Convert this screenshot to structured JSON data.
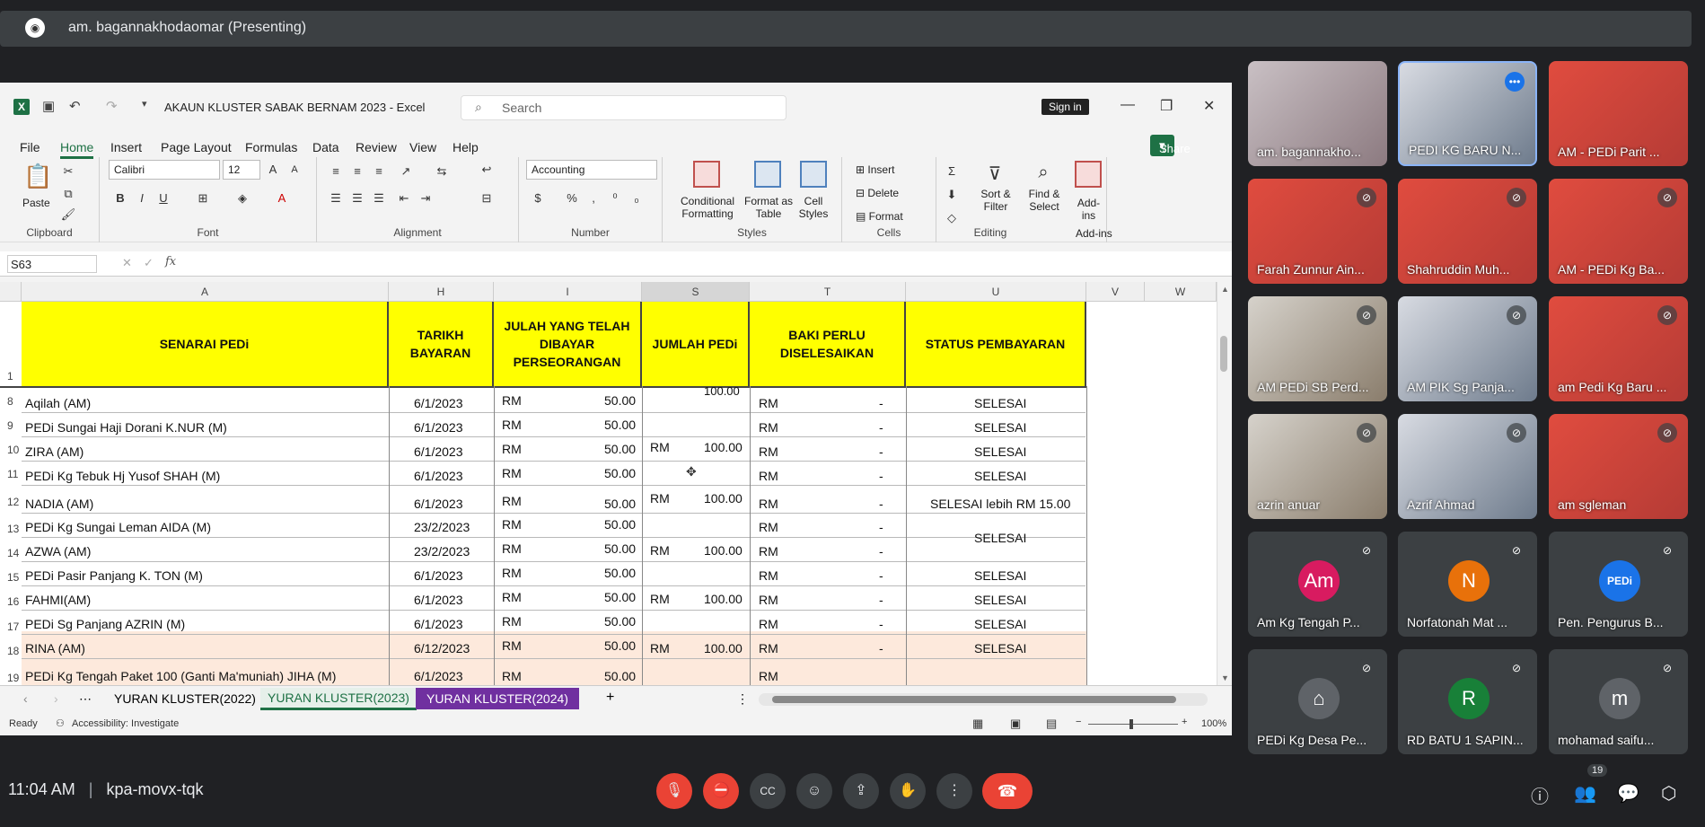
{
  "meet": {
    "presenter": "am. bagannakhodaomar (Presenting)",
    "time": "11:04 AM",
    "code": "kpa-movx-tqk",
    "participant_count": "19"
  },
  "excel": {
    "title": "AKAUN KLUSTER SABAK BERNAM 2023  -  Excel",
    "search": "Search",
    "sign_in": "Sign in",
    "menu": [
      "File",
      "Home",
      "Insert",
      "Page Layout",
      "Formulas",
      "Data",
      "Review",
      "View",
      "Help"
    ],
    "share": "Share",
    "ribbon": {
      "paste": "Paste",
      "clipboard": "Clipboard",
      "font_name": "Calibri",
      "font_size": "12",
      "font": "Font",
      "alignment": "Alignment",
      "number_format": "Accounting",
      "number": "Number",
      "cond": "Conditional Formatting",
      "fmt_table": "Format as Table",
      "cell_styles": "Cell Styles",
      "styles": "Styles",
      "insert": "Insert",
      "delete": "Delete",
      "format": "Format",
      "cells": "Cells",
      "sort": "Sort & Filter",
      "find": "Find & Select",
      "editing": "Editing",
      "addins": "Add-ins",
      "addins_group": "Add-ins"
    },
    "name_box": "S63",
    "columns": [
      "A",
      "H",
      "I",
      "S",
      "T",
      "U",
      "V",
      "W"
    ],
    "headers": [
      "SENARAI PEDi",
      "TARIKH BAYARAN",
      "JULAH YANG TELAH DIBAYAR PERSEORANGAN",
      "JUMLAH PEDi",
      "BAKI PERLU DISELESAIKAN",
      "STATUS PEMBAYARAN"
    ],
    "row_numbers": [
      "1",
      "8",
      "9",
      "10",
      "11",
      "12",
      "13",
      "14",
      "15",
      "16",
      "17",
      "18",
      "19"
    ],
    "rows": [
      {
        "name": "Aqilah (AM)",
        "date": "6/1/2023",
        "rm": "RM",
        "amt": "50.00",
        "rm2": "RM",
        "baki": "-",
        "status": "SELESAI"
      },
      {
        "name": "PEDi Sungai Haji Dorani K.NUR (M)",
        "date": "6/1/2023",
        "rm": "RM",
        "amt": "50.00",
        "rm2": "RM",
        "baki": "-",
        "status": "SELESAI"
      },
      {
        "name": "ZIRA (AM)",
        "date": "6/1/2023",
        "rm": "RM",
        "amt": "50.00",
        "rm2": "RM",
        "baki": "-",
        "status": "SELESAI"
      },
      {
        "name": "PEDi Kg Tebuk Hj Yusof  SHAH (M)",
        "date": "6/1/2023",
        "rm": "RM",
        "amt": "50.00",
        "rm2": "RM",
        "baki": "-",
        "status": "SELESAI"
      },
      {
        "name": "NADIA (AM)",
        "date": "6/1/2023",
        "rm": "RM",
        "amt": "50.00",
        "rm2": "RM",
        "baki": "-",
        "status": "SELESAI lebih RM 15.00"
      },
      {
        "name": "PEDi Kg Sungai Leman AIDA (M)",
        "date": "23/2/2023",
        "rm": "RM",
        "amt": "50.00",
        "rm2": "RM",
        "baki": "-",
        "status": ""
      },
      {
        "name": "AZWA (AM)",
        "date": "23/2/2023",
        "rm": "RM",
        "amt": "50.00",
        "rm2": "RM",
        "baki": "-",
        "status": ""
      },
      {
        "name": "PEDi Pasir Panjang K. TON (M)",
        "date": "6/1/2023",
        "rm": "RM",
        "amt": "50.00",
        "rm2": "RM",
        "baki": "-",
        "status": "SELESAI"
      },
      {
        "name": "FAHMI(AM)",
        "date": "6/1/2023",
        "rm": "RM",
        "amt": "50.00",
        "rm2": "RM",
        "baki": "-",
        "status": "SELESAI"
      },
      {
        "name": "PEDi Sg Panjang AZRIN (M)",
        "date": "6/1/2023",
        "rm": "RM",
        "amt": "50.00",
        "rm2": "RM",
        "baki": "-",
        "status": "SELESAI"
      },
      {
        "name": "RINA (AM)",
        "date": "6/12/2023",
        "rm": "RM",
        "amt": "50.00",
        "rm2": "RM",
        "baki": "-",
        "status": "SELESAI"
      },
      {
        "name": "PEDi Kg Tengah Paket 100 (Ganti Ma'muniah) JIHA (M)",
        "date": "6/1/2023",
        "rm": "RM",
        "amt": "50.00",
        "rm2": "RM",
        "baki": "",
        "status": ""
      }
    ],
    "jumlah": [
      {
        "rm": "RM",
        "val": "100.00"
      },
      {
        "rm": "RM",
        "val": "100.00"
      },
      {
        "rm": "RM",
        "val": "100.00"
      },
      {
        "rm": "RM",
        "val": "100.00"
      },
      {
        "rm": "RM",
        "val": "100.00"
      }
    ],
    "jumlah_top": "100.00",
    "merged_status": "SELESAI",
    "sheets": [
      "YURAN KLUSTER(2022)",
      "YURAN KLUSTER(2023)",
      "YURAN KLUSTER(2024)"
    ],
    "status_ready": "Ready",
    "accessibility": "Accessibility: Investigate",
    "zoom": "100%"
  },
  "participants": [
    {
      "name": "am. bagannakho...",
      "style": "photo"
    },
    {
      "name": "PEDI KG BARU N...",
      "style": "photo2"
    },
    {
      "name": "AM - PEDi Parit ...",
      "style": "photo3"
    },
    {
      "name": "Farah Zunnur Ain...",
      "style": "photo3"
    },
    {
      "name": "Shahruddin Muh...",
      "style": "photo3"
    },
    {
      "name": "AM - PEDi Kg Ba...",
      "style": "photo3"
    },
    {
      "name": "AM PEDi SB Perd...",
      "style": "photo4"
    },
    {
      "name": "AM PIK Sg Panja...",
      "style": "photo2"
    },
    {
      "name": "am Pedi Kg Baru ...",
      "style": "photo3"
    },
    {
      "name": "azrin anuar",
      "style": "photo4"
    },
    {
      "name": "Azrif Ahmad",
      "style": "photo2"
    },
    {
      "name": "am sgleman",
      "style": "photo3"
    },
    {
      "name": "Am Kg Tengah P...",
      "initial": "Am",
      "color": "#d81b60"
    },
    {
      "name": "Norfatonah Mat ...",
      "initial": "N",
      "color": "#e8710a"
    },
    {
      "name": "Pen. Pengurus B...",
      "initial": "PEDi",
      "color": "#1a73e8"
    },
    {
      "name": "PEDi Kg Desa Pe...",
      "initial": "⌂",
      "color": "#5f6368"
    },
    {
      "name": "RD BATU 1 SAPIN...",
      "initial": "R",
      "color": "#188038"
    },
    {
      "name": "mohamad saifu...",
      "initial": "m",
      "color": "#5f6368"
    }
  ]
}
